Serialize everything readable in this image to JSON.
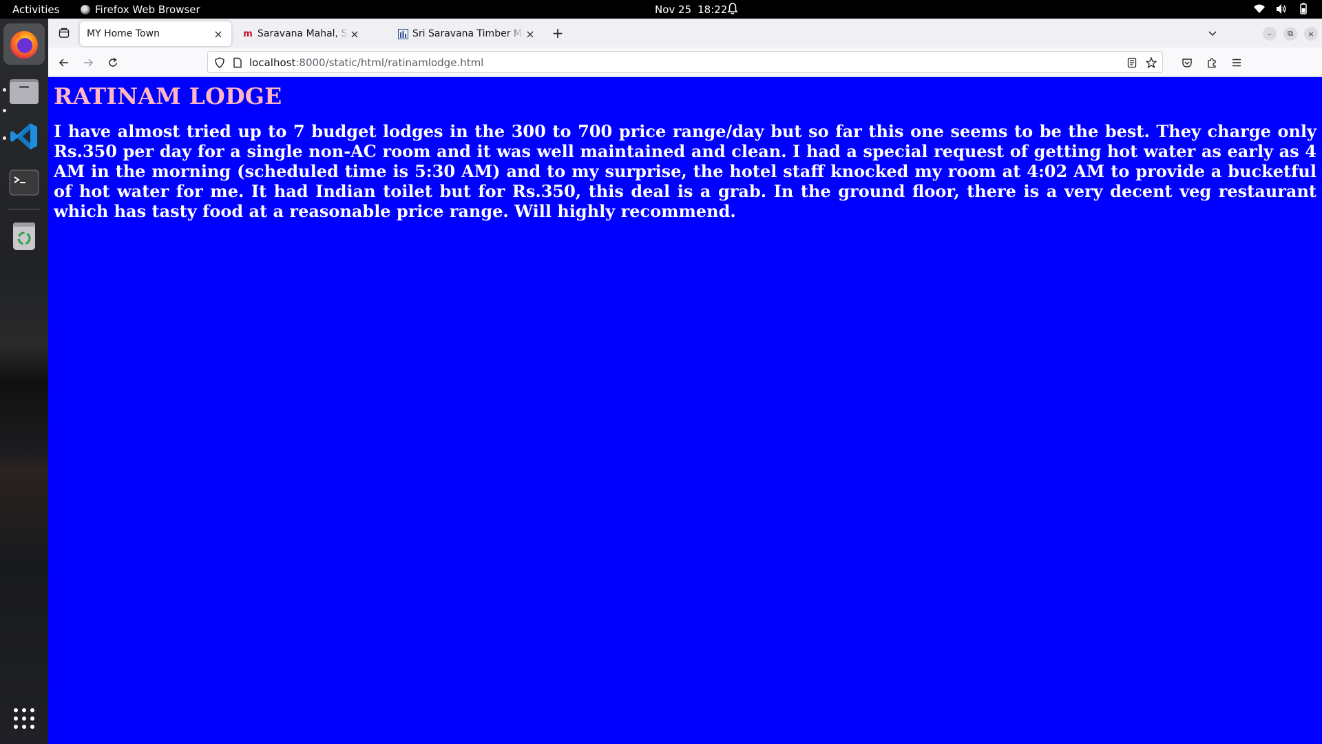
{
  "topbar": {
    "activities": "Activities",
    "app_name": "Firefox Web Browser",
    "date": "Nov 25",
    "time": "18:22"
  },
  "dock": {
    "items": [
      {
        "name": "firefox",
        "icon": "firefox-icon"
      },
      {
        "name": "files",
        "icon": "folder-icon"
      },
      {
        "name": "vscode",
        "icon": "vscode-icon"
      },
      {
        "name": "terminal",
        "icon": "terminal-icon"
      },
      {
        "name": "trash",
        "icon": "trash-icon"
      },
      {
        "name": "app-grid",
        "icon": "app-grid-icon"
      }
    ]
  },
  "tabs": [
    {
      "title": "MY Home Town",
      "active": true
    },
    {
      "title": "Saravana Mahal, Solar, Er",
      "favicon": "m",
      "favicon_color": "#c8102e"
    },
    {
      "title": "Sri Saravana Timber Mart",
      "favicon": "chart"
    }
  ],
  "urlbar": {
    "host": "localhost",
    "path": ":8000/static/html/ratinamlodge.html"
  },
  "page": {
    "heading": "RATINAM LODGE",
    "body": "I have almost tried up to 7 budget lodges in the 300 to 700 price range/day but so far this one seems to be the best. They charge only Rs.350 per day for a single non-AC room and it was well maintained and clean. I had a special request of getting hot water as early as 4 AM in the morning (scheduled time is 5:30 AM) and to my surprise, the hotel staff knocked my room at 4:02 AM to provide a bucketful of hot water for me. It had Indian toilet but for Rs.350, this deal is a grab. In the ground floor, there is a very decent veg restaurant which has tasty food at a reasonable price range. Will highly recommend.",
    "background": "#0000ff",
    "heading_color": "#ffb6c1",
    "text_color": "#ffffff"
  }
}
